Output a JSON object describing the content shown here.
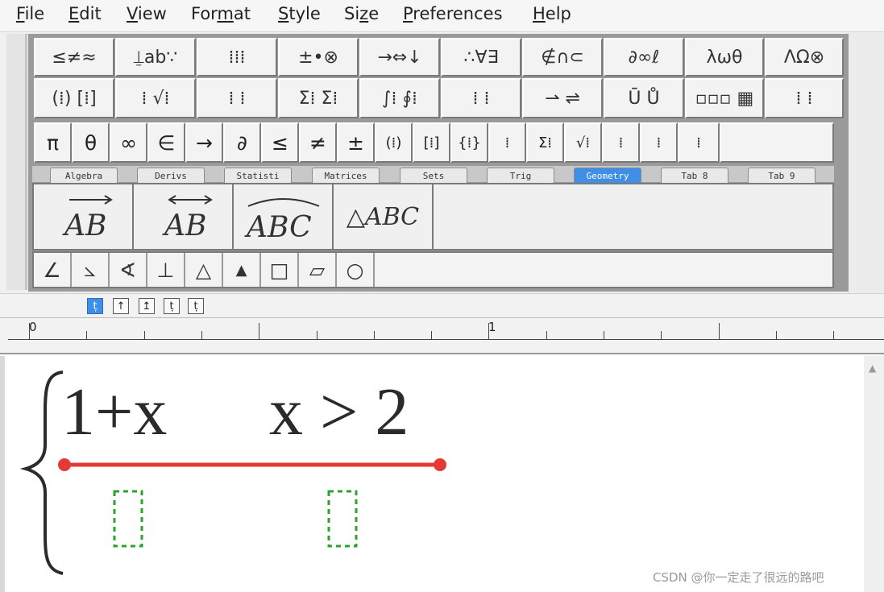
{
  "menu": [
    {
      "pre": "",
      "u": "F",
      "post": "ile"
    },
    {
      "pre": "",
      "u": "E",
      "post": "dit"
    },
    {
      "pre": "",
      "u": "V",
      "post": "iew"
    },
    {
      "pre": "For",
      "u": "m",
      "post": "at"
    },
    {
      "pre": "",
      "u": "S",
      "post": "tyle"
    },
    {
      "pre": "Si",
      "u": "z",
      "post": "e"
    },
    {
      "pre": "",
      "u": "P",
      "post": "references"
    },
    {
      "pre": "",
      "u": "H",
      "post": "elp"
    }
  ],
  "palette_row1": [
    "≤≠≈",
    "⍊ab∵",
    "⁞⁞⁞",
    "±•⊗",
    "→⇔↓",
    "∴∀∃",
    "∉∩⊂",
    "∂∞ℓ",
    "λωθ",
    "ΛΩ⊗"
  ],
  "palette_row2": [
    "(⁞) [⁞]",
    "⁞ √⁞",
    "⁞ ⁞",
    "Σ⁞ Σ⁞",
    "∫⁞ ∮⁞",
    "⁞ ⁞",
    "⇀ ⇌",
    "Ū Ů",
    "▫▫▫ ▦",
    "⁞ ⁞"
  ],
  "symbol_row": [
    "π",
    "θ",
    "∞",
    "∈",
    "→",
    "∂",
    "≤",
    "≠",
    "±",
    "(⁞)",
    "[⁞]",
    "{⁞}",
    "⁞",
    "Σ⁞",
    "√⁞",
    "⁞",
    "⁞",
    "⁞"
  ],
  "tabs": [
    "Algebra",
    "Derivs",
    "Statisti",
    "Matrices",
    "Sets",
    "Trig",
    "Geometry",
    "Tab 8",
    "Tab 9"
  ],
  "active_tab": "Geometry",
  "geometry_templates": [
    "AB",
    "AB",
    "ABC",
    "△ABC"
  ],
  "shapes": [
    "∠",
    "⦣",
    "∢",
    "⊥",
    "△",
    "▲",
    "□",
    "▱",
    "○"
  ],
  "nudge_buttons": [
    "ṭ",
    "↑",
    "↥",
    "ṭ",
    "ṭ"
  ],
  "ruler_labels": [
    "0",
    "1"
  ],
  "equation": {
    "brace": "{",
    "term1": "1+x",
    "term2": "x > 2"
  },
  "watermark": "CSDN @你一定走了很远的路吧",
  "colors": {
    "accent": "#3f8fe6",
    "annotation_line": "#e53935",
    "placeholder": "#2aa52a"
  }
}
